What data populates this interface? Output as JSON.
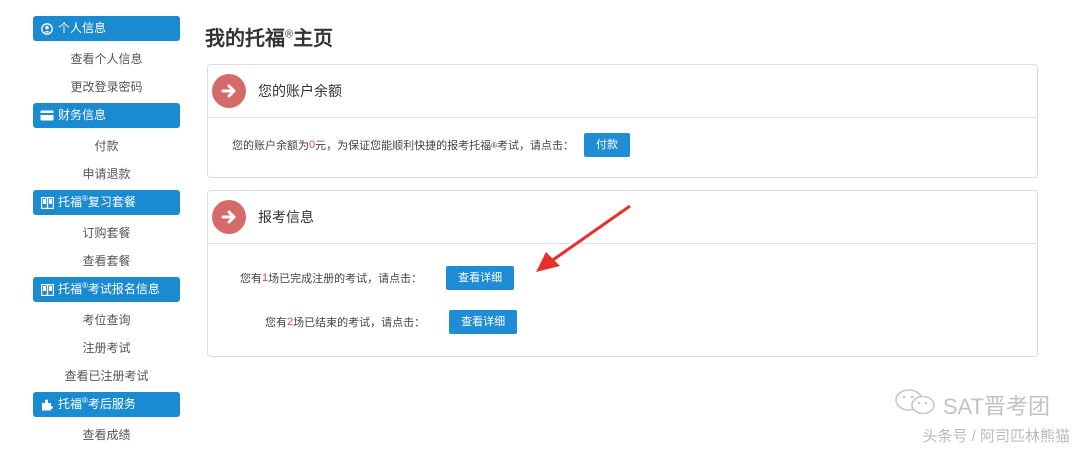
{
  "sidebar": {
    "sections": [
      {
        "title": "个人信息",
        "icon": "user-circle-icon",
        "links": [
          "查看个人信息",
          "更改登录密码"
        ]
      },
      {
        "title": "财务信息",
        "icon": "credit-card-icon",
        "links": [
          "付款",
          "申请退款"
        ]
      },
      {
        "title_pre": "托福",
        "title_sup": "®",
        "title_post": "复习套餐",
        "icon": "book-icon",
        "links": [
          "订购套餐",
          "查看套餐"
        ]
      },
      {
        "title_pre": "托福",
        "title_sup": "®",
        "title_post": "考试报名信息",
        "icon": "book-icon",
        "links": [
          "考位查询",
          "注册考试",
          "查看已注册考试"
        ]
      },
      {
        "title_pre": "托福",
        "title_sup": "®",
        "title_post": "考后服务",
        "icon": "puzzle-icon",
        "links": [
          "查看成绩"
        ]
      }
    ]
  },
  "main": {
    "title_pre": "我的托福",
    "title_sup": "®",
    "title_post": "主页",
    "balance_panel": {
      "title": "您的账户余额",
      "text_a": "您的账户余额为",
      "amount": "0",
      "text_b": "元，为保证您能顺利快捷的报考托福",
      "sup": "®",
      "text_c": "考试，请点击：",
      "button": "付款"
    },
    "exam_panel": {
      "title": "报考信息",
      "row1_a": "您有",
      "row1_n": "1",
      "row1_b": "场已完成注册的考试，请点击：",
      "row1_button": "查看详细",
      "row2_a": "您有",
      "row2_n": "2",
      "row2_b": "场已结束的考试，请点击：",
      "row2_button": "查看详细"
    }
  },
  "watermark": {
    "line1": "SAT晋考团",
    "line2": "头条号 / 阿司匹林熊猫"
  },
  "colors": {
    "accent": "#1a8bd0",
    "badge": "#d46a6a",
    "highlight": "#e14b3a"
  }
}
